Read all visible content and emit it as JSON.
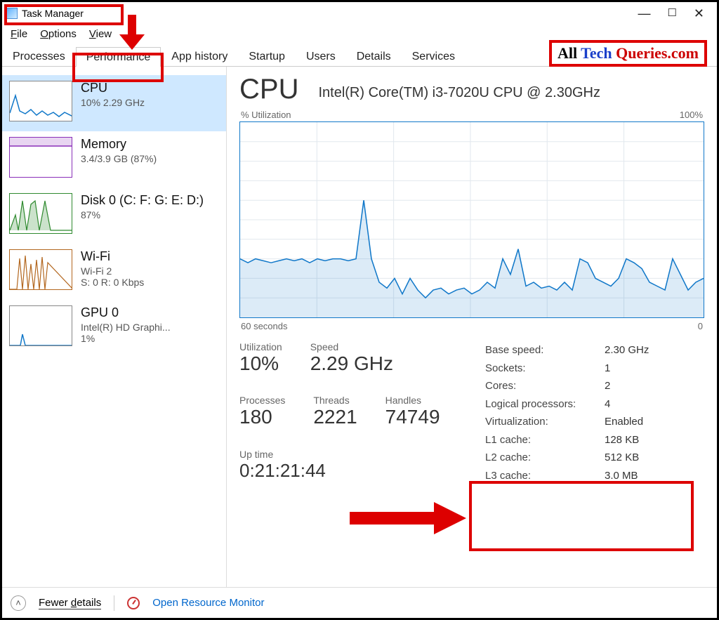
{
  "app": {
    "title": "Task Manager"
  },
  "menu": {
    "file": "File",
    "options": "Options",
    "view": "View"
  },
  "tabs": [
    {
      "label": "Processes",
      "active": false
    },
    {
      "label": "Performance",
      "active": true
    },
    {
      "label": "App history",
      "active": false
    },
    {
      "label": "Startup",
      "active": false
    },
    {
      "label": "Users",
      "active": false
    },
    {
      "label": "Details",
      "active": false
    },
    {
      "label": "Services",
      "active": false
    }
  ],
  "brand": {
    "w1": "All",
    "w2": "Tech",
    "w3": "Queries.com"
  },
  "sidebar": [
    {
      "title": "CPU",
      "sub1": "10% 2.29 GHz",
      "sub2": "",
      "color": "#1178c9"
    },
    {
      "title": "Memory",
      "sub1": "3.4/3.9 GB (87%)",
      "sub2": "",
      "color": "#8a2fb8"
    },
    {
      "title": "Disk 0 (C: F: G: E: D:)",
      "sub1": "87%",
      "sub2": "",
      "color": "#2f8a2f"
    },
    {
      "title": "Wi-Fi",
      "sub1": "Wi-Fi 2",
      "sub2": "S: 0 R: 0 Kbps",
      "color": "#b3671f"
    },
    {
      "title": "GPU 0",
      "sub1": "Intel(R) HD Graphi...",
      "sub2": "1%",
      "color": "#1178c9"
    }
  ],
  "main": {
    "heading": "CPU",
    "sub": "Intel(R) Core(TM) i3-7020U CPU @ 2.30GHz",
    "chart_top_left": "% Utilization",
    "chart_top_right": "100%",
    "chart_bottom_left": "60 seconds",
    "chart_bottom_right": "0",
    "stats": {
      "utilization_lbl": "Utilization",
      "utilization_val": "10%",
      "speed_lbl": "Speed",
      "speed_val": "2.29 GHz",
      "processes_lbl": "Processes",
      "processes_val": "180",
      "threads_lbl": "Threads",
      "threads_val": "2221",
      "handles_lbl": "Handles",
      "handles_val": "74749",
      "uptime_lbl": "Up time",
      "uptime_val": "0:21:21:44"
    },
    "specs": [
      {
        "k": "Base speed:",
        "v": "2.30 GHz"
      },
      {
        "k": "Sockets:",
        "v": "1"
      },
      {
        "k": "Cores:",
        "v": "2"
      },
      {
        "k": "Logical processors:",
        "v": "4"
      },
      {
        "k": "Virtualization:",
        "v": "Enabled"
      },
      {
        "k": "L1 cache:",
        "v": "128 KB"
      },
      {
        "k": "L2 cache:",
        "v": "512 KB"
      },
      {
        "k": "L3 cache:",
        "v": "3.0 MB"
      }
    ]
  },
  "footer": {
    "fewer": "Fewer details",
    "rm": "Open Resource Monitor"
  },
  "chart_data": {
    "type": "line",
    "title": "% Utilization",
    "xlabel": "60 seconds",
    "ylabel": "% Utilization",
    "ylim": [
      0,
      100
    ],
    "x": [
      0,
      1,
      2,
      3,
      4,
      5,
      6,
      7,
      8,
      9,
      10,
      11,
      12,
      13,
      14,
      15,
      16,
      17,
      18,
      19,
      20,
      21,
      22,
      23,
      24,
      25,
      26,
      27,
      28,
      29,
      30,
      31,
      32,
      33,
      34,
      35,
      36,
      37,
      38,
      39,
      40,
      41,
      42,
      43,
      44,
      45,
      46,
      47,
      48,
      49,
      50,
      51,
      52,
      53,
      54,
      55,
      56,
      57,
      58,
      59,
      60
    ],
    "series": [
      {
        "name": "CPU",
        "values": [
          30,
          28,
          30,
          29,
          28,
          29,
          30,
          29,
          30,
          28,
          30,
          29,
          30,
          30,
          29,
          30,
          60,
          30,
          18,
          15,
          20,
          12,
          20,
          14,
          10,
          14,
          15,
          12,
          14,
          15,
          12,
          14,
          18,
          15,
          30,
          22,
          35,
          16,
          18,
          15,
          16,
          14,
          18,
          14,
          30,
          28,
          20,
          18,
          16,
          20,
          30,
          28,
          25,
          18,
          16,
          14,
          30,
          22,
          14,
          18,
          20
        ]
      }
    ]
  }
}
